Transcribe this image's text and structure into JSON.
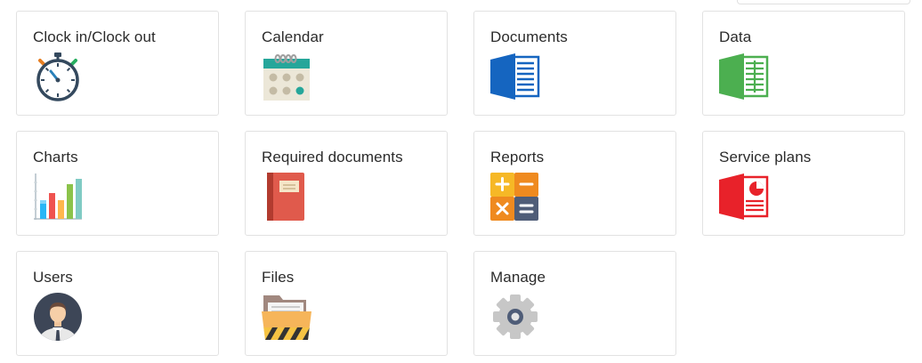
{
  "tiles": [
    {
      "label": "Clock in/Clock out",
      "icon": "stopwatch-icon"
    },
    {
      "label": "Calendar",
      "icon": "calendar-icon"
    },
    {
      "label": "Documents",
      "icon": "word-document-icon"
    },
    {
      "label": "Data",
      "icon": "spreadsheet-icon"
    },
    {
      "label": "Charts",
      "icon": "bar-chart-icon"
    },
    {
      "label": "Required documents",
      "icon": "notebook-icon"
    },
    {
      "label": "Reports",
      "icon": "calculator-icon"
    },
    {
      "label": "Service plans",
      "icon": "presentation-document-icon"
    },
    {
      "label": "Users",
      "icon": "user-avatar-icon"
    },
    {
      "label": "Files",
      "icon": "folder-icon"
    },
    {
      "label": "Manage",
      "icon": "gear-icon"
    }
  ],
  "colors": {
    "document_blue": "#1565c0",
    "data_green": "#4caf50",
    "service_red": "#e8222a",
    "tile_border": "#e2e2e2"
  }
}
